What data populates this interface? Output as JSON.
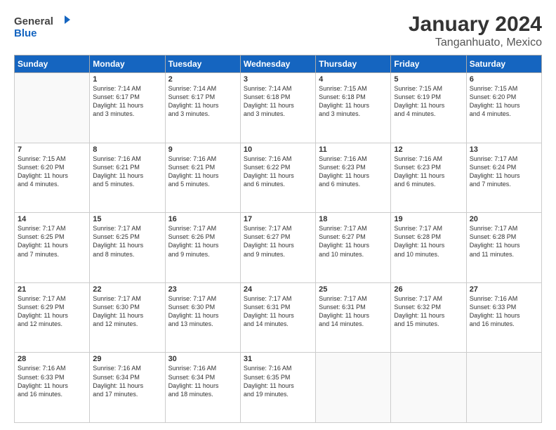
{
  "header": {
    "logo_general": "General",
    "logo_blue": "Blue",
    "title": "January 2024",
    "subtitle": "Tanganhuato, Mexico"
  },
  "days_of_week": [
    "Sunday",
    "Monday",
    "Tuesday",
    "Wednesday",
    "Thursday",
    "Friday",
    "Saturday"
  ],
  "weeks": [
    [
      {
        "num": "",
        "info": ""
      },
      {
        "num": "1",
        "info": "Sunrise: 7:14 AM\nSunset: 6:17 PM\nDaylight: 11 hours\nand 3 minutes."
      },
      {
        "num": "2",
        "info": "Sunrise: 7:14 AM\nSunset: 6:17 PM\nDaylight: 11 hours\nand 3 minutes."
      },
      {
        "num": "3",
        "info": "Sunrise: 7:14 AM\nSunset: 6:18 PM\nDaylight: 11 hours\nand 3 minutes."
      },
      {
        "num": "4",
        "info": "Sunrise: 7:15 AM\nSunset: 6:18 PM\nDaylight: 11 hours\nand 3 minutes."
      },
      {
        "num": "5",
        "info": "Sunrise: 7:15 AM\nSunset: 6:19 PM\nDaylight: 11 hours\nand 4 minutes."
      },
      {
        "num": "6",
        "info": "Sunrise: 7:15 AM\nSunset: 6:20 PM\nDaylight: 11 hours\nand 4 minutes."
      }
    ],
    [
      {
        "num": "7",
        "info": "Sunrise: 7:15 AM\nSunset: 6:20 PM\nDaylight: 11 hours\nand 4 minutes."
      },
      {
        "num": "8",
        "info": "Sunrise: 7:16 AM\nSunset: 6:21 PM\nDaylight: 11 hours\nand 5 minutes."
      },
      {
        "num": "9",
        "info": "Sunrise: 7:16 AM\nSunset: 6:21 PM\nDaylight: 11 hours\nand 5 minutes."
      },
      {
        "num": "10",
        "info": "Sunrise: 7:16 AM\nSunset: 6:22 PM\nDaylight: 11 hours\nand 6 minutes."
      },
      {
        "num": "11",
        "info": "Sunrise: 7:16 AM\nSunset: 6:23 PM\nDaylight: 11 hours\nand 6 minutes."
      },
      {
        "num": "12",
        "info": "Sunrise: 7:16 AM\nSunset: 6:23 PM\nDaylight: 11 hours\nand 6 minutes."
      },
      {
        "num": "13",
        "info": "Sunrise: 7:17 AM\nSunset: 6:24 PM\nDaylight: 11 hours\nand 7 minutes."
      }
    ],
    [
      {
        "num": "14",
        "info": "Sunrise: 7:17 AM\nSunset: 6:25 PM\nDaylight: 11 hours\nand 7 minutes."
      },
      {
        "num": "15",
        "info": "Sunrise: 7:17 AM\nSunset: 6:25 PM\nDaylight: 11 hours\nand 8 minutes."
      },
      {
        "num": "16",
        "info": "Sunrise: 7:17 AM\nSunset: 6:26 PM\nDaylight: 11 hours\nand 9 minutes."
      },
      {
        "num": "17",
        "info": "Sunrise: 7:17 AM\nSunset: 6:27 PM\nDaylight: 11 hours\nand 9 minutes."
      },
      {
        "num": "18",
        "info": "Sunrise: 7:17 AM\nSunset: 6:27 PM\nDaylight: 11 hours\nand 10 minutes."
      },
      {
        "num": "19",
        "info": "Sunrise: 7:17 AM\nSunset: 6:28 PM\nDaylight: 11 hours\nand 10 minutes."
      },
      {
        "num": "20",
        "info": "Sunrise: 7:17 AM\nSunset: 6:28 PM\nDaylight: 11 hours\nand 11 minutes."
      }
    ],
    [
      {
        "num": "21",
        "info": "Sunrise: 7:17 AM\nSunset: 6:29 PM\nDaylight: 11 hours\nand 12 minutes."
      },
      {
        "num": "22",
        "info": "Sunrise: 7:17 AM\nSunset: 6:30 PM\nDaylight: 11 hours\nand 12 minutes."
      },
      {
        "num": "23",
        "info": "Sunrise: 7:17 AM\nSunset: 6:30 PM\nDaylight: 11 hours\nand 13 minutes."
      },
      {
        "num": "24",
        "info": "Sunrise: 7:17 AM\nSunset: 6:31 PM\nDaylight: 11 hours\nand 14 minutes."
      },
      {
        "num": "25",
        "info": "Sunrise: 7:17 AM\nSunset: 6:31 PM\nDaylight: 11 hours\nand 14 minutes."
      },
      {
        "num": "26",
        "info": "Sunrise: 7:17 AM\nSunset: 6:32 PM\nDaylight: 11 hours\nand 15 minutes."
      },
      {
        "num": "27",
        "info": "Sunrise: 7:16 AM\nSunset: 6:33 PM\nDaylight: 11 hours\nand 16 minutes."
      }
    ],
    [
      {
        "num": "28",
        "info": "Sunrise: 7:16 AM\nSunset: 6:33 PM\nDaylight: 11 hours\nand 16 minutes."
      },
      {
        "num": "29",
        "info": "Sunrise: 7:16 AM\nSunset: 6:34 PM\nDaylight: 11 hours\nand 17 minutes."
      },
      {
        "num": "30",
        "info": "Sunrise: 7:16 AM\nSunset: 6:34 PM\nDaylight: 11 hours\nand 18 minutes."
      },
      {
        "num": "31",
        "info": "Sunrise: 7:16 AM\nSunset: 6:35 PM\nDaylight: 11 hours\nand 19 minutes."
      },
      {
        "num": "",
        "info": ""
      },
      {
        "num": "",
        "info": ""
      },
      {
        "num": "",
        "info": ""
      }
    ]
  ]
}
